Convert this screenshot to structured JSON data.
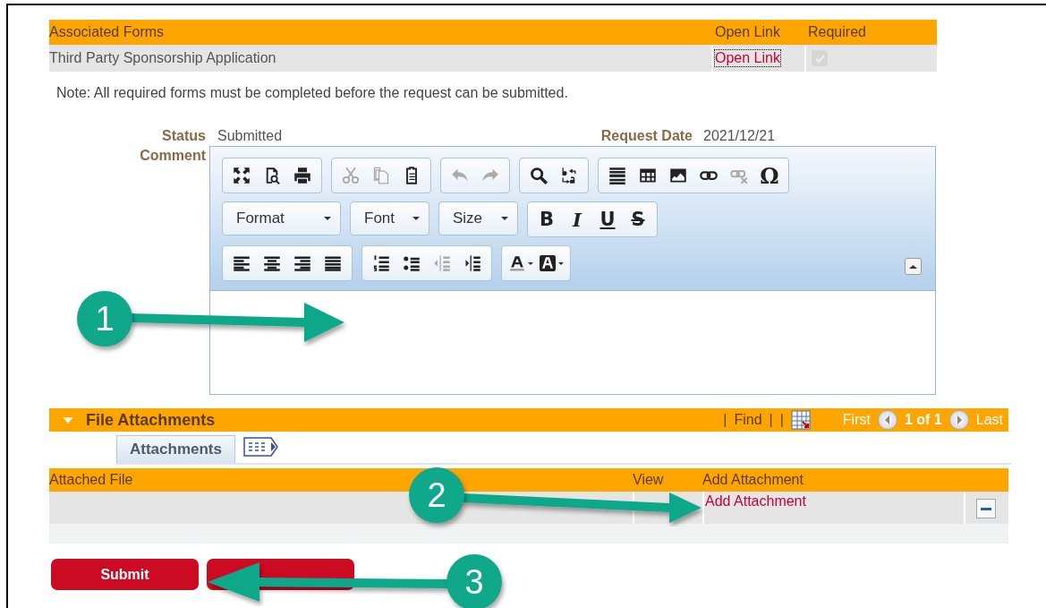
{
  "associated_forms": {
    "columns": [
      "Associated Forms",
      "Open Link",
      "Required"
    ],
    "rows": [
      {
        "name": "Third Party Sponsorship Application",
        "link": "Open Link",
        "required": true,
        "disabled": true
      }
    ]
  },
  "note": "Note: All required forms must be completed before the request can be submitted.",
  "status": {
    "label": "Status",
    "value": "Submitted"
  },
  "request_date": {
    "label": "Request Date",
    "value": "2021/12/21"
  },
  "comment": {
    "label": "Comment",
    "toolbar": [
      [
        [
          {
            "kind": "icon",
            "disabled": false
          },
          {
            "kind": "icon",
            "disabled": false
          },
          {
            "kind": "icon",
            "disabled": false
          }
        ],
        [
          {
            "kind": "icon",
            "disabled": true
          },
          {
            "kind": "icon",
            "disabled": true
          },
          {
            "kind": "icon",
            "disabled": false
          }
        ],
        [
          {
            "kind": "icon",
            "disabled": true
          },
          {
            "kind": "icon",
            "disabled": true
          }
        ],
        [
          {
            "kind": "icon",
            "disabled": false
          },
          {
            "kind": "icon",
            "disabled": false
          }
        ],
        [
          {
            "kind": "icon",
            "disabled": false
          },
          {
            "kind": "icon",
            "disabled": false
          },
          {
            "kind": "icon",
            "disabled": false
          },
          {
            "kind": "icon",
            "disabled": false
          },
          {
            "kind": "icon",
            "disabled": true
          },
          {
            "kind": "glyph",
            "label": "Ω"
          }
        ]
      ],
      [
        [
          {
            "kind": "combo",
            "label": "Format"
          }
        ],
        [
          {
            "kind": "combo",
            "label": "Font"
          }
        ],
        [
          {
            "kind": "combo",
            "label": "Size"
          }
        ],
        [
          {
            "kind": "glyph",
            "label": "B"
          },
          {
            "kind": "glyph",
            "label": "I"
          },
          {
            "kind": "glyph",
            "label": "U"
          },
          {
            "kind": "glyph",
            "label": "S"
          }
        ]
      ],
      [
        [
          {
            "kind": "icon",
            "disabled": false
          },
          {
            "kind": "icon",
            "disabled": false
          },
          {
            "kind": "icon",
            "disabled": false
          },
          {
            "kind": "icon",
            "disabled": false
          }
        ],
        [
          {
            "kind": "icon",
            "disabled": false
          },
          {
            "kind": "icon",
            "disabled": false
          },
          {
            "kind": "icon",
            "disabled": true
          },
          {
            "kind": "icon",
            "disabled": false
          }
        ],
        [
          {
            "kind": "icon",
            "disabled": false
          },
          {
            "kind": "icon",
            "disabled": false
          }
        ]
      ]
    ]
  },
  "file_attachments": {
    "title": "File Attachments",
    "expanded": true,
    "pipes": [
      "|",
      "|",
      "|"
    ],
    "find": "Find",
    "first": "First",
    "page": "1 of 1",
    "last": "Last",
    "tabs": [
      {
        "label": "Attachments",
        "selected": true
      }
    ],
    "columns": [
      "Attached File",
      "View",
      "Add Attachment"
    ],
    "rows": [
      {
        "add": "Add Attachment"
      }
    ]
  },
  "buttons": [
    {
      "kind": "labelled",
      "label": "Submit"
    },
    {
      "kind": "covered"
    }
  ],
  "callouts": [
    {
      "number": "1"
    },
    {
      "number": "2"
    },
    {
      "number": "3"
    }
  ]
}
